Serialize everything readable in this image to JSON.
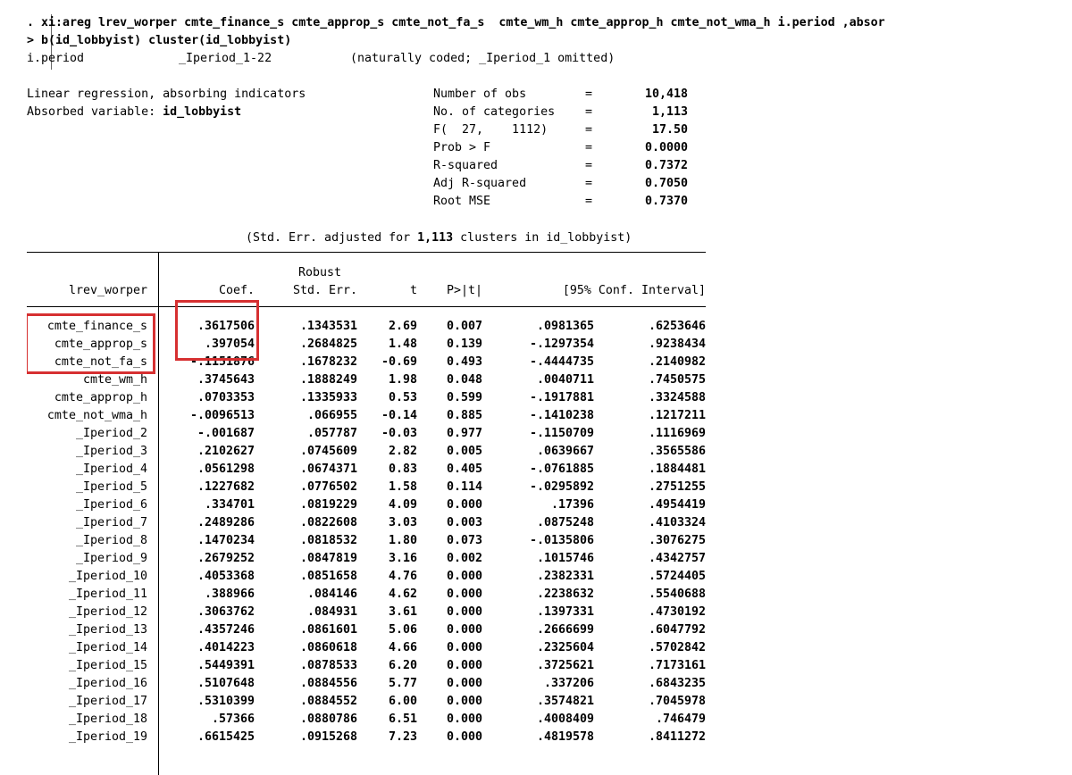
{
  "command": {
    "line1": ". xi:areg lrev_worper cmte_finance_s cmte_approp_s cmte_not_fa_s  cmte_wm_h cmte_approp_h cmte_not_wma_h i.period ,absor",
    "line2": "> b(id_lobbyist) cluster(id_lobbyist)"
  },
  "xi_line": {
    "var": "i.period",
    "dummies": "_Iperiod_1-22",
    "note": "(naturally coded; _Iperiod_1 omitted)"
  },
  "header": {
    "title": "Linear regression, absorbing indicators",
    "absorbed_label": "Absorbed variable: ",
    "absorbed_var": "id_lobbyist",
    "stats": [
      {
        "label": "Number of obs",
        "value": "10,418"
      },
      {
        "label": "No. of categories",
        "value": "1,113"
      },
      {
        "label": "F(  27,    1112)",
        "value": "17.50"
      },
      {
        "label": "Prob > F",
        "value": "0.0000"
      },
      {
        "label": "R-squared",
        "value": "0.7372"
      },
      {
        "label": "Adj R-squared",
        "value": "0.7050"
      },
      {
        "label": "Root MSE",
        "value": "0.7370"
      }
    ],
    "cluster_note_pre": "(Std. Err. adjusted for ",
    "cluster_note_num": "1,113",
    "cluster_note_post": " clusters in id_lobbyist)"
  },
  "table": {
    "depvar": "lrev_worper",
    "col_robust": "Robust",
    "columns": [
      "Coef.",
      "Std. Err.",
      "t",
      "P>|t|",
      "[95% Conf. Interval]"
    ],
    "rows": [
      {
        "name": "cmte_finance_s",
        "coef": ".3617506",
        "se": ".1343531",
        "t": "2.69",
        "p": "0.007",
        "lo": ".0981365",
        "hi": ".6253646"
      },
      {
        "name": "cmte_approp_s",
        "coef": ".397054",
        "se": ".2684825",
        "t": "1.48",
        "p": "0.139",
        "lo": "-.1297354",
        "hi": ".9238434"
      },
      {
        "name": "cmte_not_fa_s",
        "coef": "-.1151876",
        "se": ".1678232",
        "t": "-0.69",
        "p": "0.493",
        "lo": "-.4444735",
        "hi": ".2140982"
      },
      {
        "name": "cmte_wm_h",
        "coef": ".3745643",
        "se": ".1888249",
        "t": "1.98",
        "p": "0.048",
        "lo": ".0040711",
        "hi": ".7450575"
      },
      {
        "name": "cmte_approp_h",
        "coef": ".0703353",
        "se": ".1335933",
        "t": "0.53",
        "p": "0.599",
        "lo": "-.1917881",
        "hi": ".3324588"
      },
      {
        "name": "cmte_not_wma_h",
        "coef": "-.0096513",
        "se": ".066955",
        "t": "-0.14",
        "p": "0.885",
        "lo": "-.1410238",
        "hi": ".1217211"
      },
      {
        "name": "_Iperiod_2",
        "coef": "-.001687",
        "se": ".057787",
        "t": "-0.03",
        "p": "0.977",
        "lo": "-.1150709",
        "hi": ".1116969"
      },
      {
        "name": "_Iperiod_3",
        "coef": ".2102627",
        "se": ".0745609",
        "t": "2.82",
        "p": "0.005",
        "lo": ".0639667",
        "hi": ".3565586"
      },
      {
        "name": "_Iperiod_4",
        "coef": ".0561298",
        "se": ".0674371",
        "t": "0.83",
        "p": "0.405",
        "lo": "-.0761885",
        "hi": ".1884481"
      },
      {
        "name": "_Iperiod_5",
        "coef": ".1227682",
        "se": ".0776502",
        "t": "1.58",
        "p": "0.114",
        "lo": "-.0295892",
        "hi": ".2751255"
      },
      {
        "name": "_Iperiod_6",
        "coef": ".334701",
        "se": ".0819229",
        "t": "4.09",
        "p": "0.000",
        "lo": ".17396",
        "hi": ".4954419"
      },
      {
        "name": "_Iperiod_7",
        "coef": ".2489286",
        "se": ".0822608",
        "t": "3.03",
        "p": "0.003",
        "lo": ".0875248",
        "hi": ".4103324"
      },
      {
        "name": "_Iperiod_8",
        "coef": ".1470234",
        "se": ".0818532",
        "t": "1.80",
        "p": "0.073",
        "lo": "-.0135806",
        "hi": ".3076275"
      },
      {
        "name": "_Iperiod_9",
        "coef": ".2679252",
        "se": ".0847819",
        "t": "3.16",
        "p": "0.002",
        "lo": ".1015746",
        "hi": ".4342757"
      },
      {
        "name": "_Iperiod_10",
        "coef": ".4053368",
        "se": ".0851658",
        "t": "4.76",
        "p": "0.000",
        "lo": ".2382331",
        "hi": ".5724405"
      },
      {
        "name": "_Iperiod_11",
        "coef": ".388966",
        "se": ".084146",
        "t": "4.62",
        "p": "0.000",
        "lo": ".2238632",
        "hi": ".5540688"
      },
      {
        "name": "_Iperiod_12",
        "coef": ".3063762",
        "se": ".084931",
        "t": "3.61",
        "p": "0.000",
        "lo": ".1397331",
        "hi": ".4730192"
      },
      {
        "name": "_Iperiod_13",
        "coef": ".4357246",
        "se": ".0861601",
        "t": "5.06",
        "p": "0.000",
        "lo": ".2666699",
        "hi": ".6047792"
      },
      {
        "name": "_Iperiod_14",
        "coef": ".4014223",
        "se": ".0860618",
        "t": "4.66",
        "p": "0.000",
        "lo": ".2325604",
        "hi": ".5702842"
      },
      {
        "name": "_Iperiod_15",
        "coef": ".5449391",
        "se": ".0878533",
        "t": "6.20",
        "p": "0.000",
        "lo": ".3725621",
        "hi": ".7173161"
      },
      {
        "name": "_Iperiod_16",
        "coef": ".5107648",
        "se": ".0884556",
        "t": "5.77",
        "p": "0.000",
        "lo": ".337206",
        "hi": ".6843235"
      },
      {
        "name": "_Iperiod_17",
        "coef": ".5310399",
        "se": ".0884552",
        "t": "6.00",
        "p": "0.000",
        "lo": ".3574821",
        "hi": ".7045978"
      },
      {
        "name": "_Iperiod_18",
        "coef": ".57366",
        "se": ".0880786",
        "t": "6.51",
        "p": "0.000",
        "lo": ".4008409",
        "hi": ".746479"
      },
      {
        "name": "_Iperiod_19",
        "coef": ".6615425",
        "se": ".0915268",
        "t": "7.23",
        "p": "0.000",
        "lo": ".4819578",
        "hi": ".8411272"
      }
    ]
  },
  "highlight_color": "#d63031"
}
